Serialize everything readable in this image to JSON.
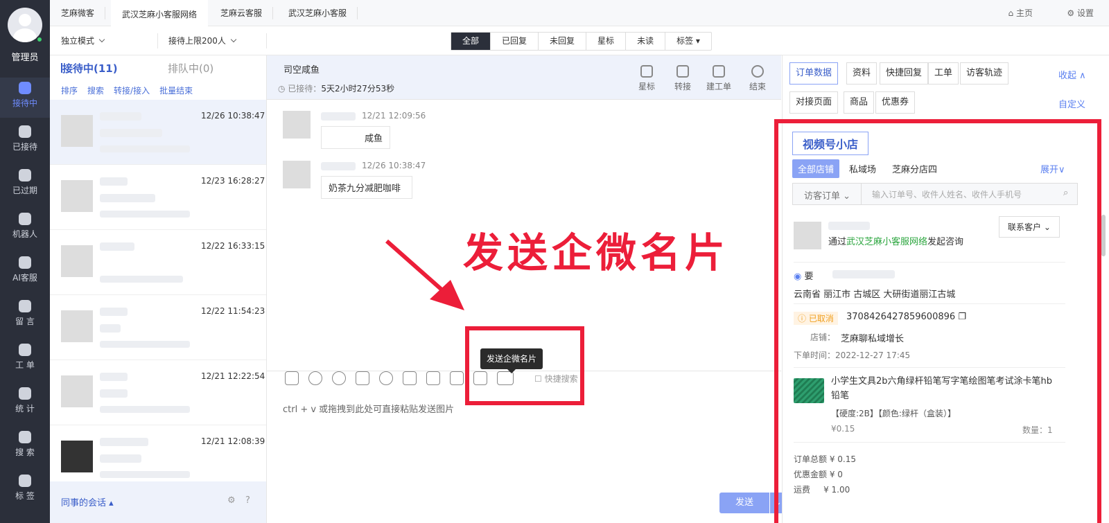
{
  "nav": {
    "admin": "管理员",
    "items": [
      {
        "label": "接待中",
        "icon": "chat-icon",
        "active": true
      },
      {
        "label": "已接待",
        "icon": "check-icon"
      },
      {
        "label": "已过期",
        "icon": "expired-icon"
      },
      {
        "label": "机器人",
        "icon": "robot-icon"
      },
      {
        "label": "AI客服",
        "icon": "ai-icon"
      },
      {
        "label": "留 言",
        "icon": "message-icon"
      },
      {
        "label": "工 单",
        "icon": "ticket-icon"
      },
      {
        "label": "统 计",
        "icon": "stats-icon"
      },
      {
        "label": "搜 索",
        "icon": "search-icon"
      },
      {
        "label": "标 签",
        "icon": "tag-icon"
      }
    ]
  },
  "tabs": [
    "芝麻微客",
    "武汉芝麻小客服网络",
    "芝麻云客服",
    "武汉芝麻小客服"
  ],
  "top": {
    "home": "主页",
    "settings": "设置"
  },
  "bar2": {
    "mode": "独立模式",
    "limit": "接待上限200人",
    "filters": [
      "全部",
      "已回复",
      "未回复",
      "星标",
      "未读",
      "标签 ▾"
    ]
  },
  "list": {
    "active_tab": "接待中(11)",
    "queue_tab": "排队中(0)",
    "actions": [
      "排序",
      "搜索",
      "转接/接入",
      "批量结束"
    ],
    "times": [
      "12/26 10:38:47",
      "12/23 16:28:27",
      "12/22 16:33:15",
      "12/22 11:54:23",
      "12/21 12:22:54",
      "12/21 12:08:39"
    ],
    "colleague": "同事的会话 ▴"
  },
  "chat": {
    "name": "司空咸鱼",
    "waited": "已接待：",
    "duration": "5天2小时27分53秒",
    "header_buttons": [
      "星标",
      "转接",
      "建工单",
      "结束"
    ],
    "messages": [
      {
        "time": "12/21 12:09:56",
        "text": "咸鱼"
      },
      {
        "time": "12/26 10:38:47",
        "text": "奶茶九分减肥咖啡"
      }
    ],
    "input_placeholder": "ctrl + v 或拖拽到此处可直接粘贴发送图片",
    "quick_search": "快捷搜索",
    "tooltip": "发送企微名片",
    "send": "发送"
  },
  "annotation": "发送企微名片",
  "right": {
    "tabs_row1": [
      "订单数据",
      "资料",
      "快捷回复",
      "工单",
      "访客轨迹"
    ],
    "collapse": "收起 ∧",
    "tabs_row2": [
      "对接页面",
      "商品",
      "优惠券"
    ],
    "customize": "自定义",
    "shop_title": "视频号小店",
    "shop_tabs": [
      "全部店铺",
      "私域场",
      "芝麻分店四"
    ],
    "expand": "展开∨",
    "order_type": "访客订单",
    "search_placeholder": "输入订单号、收件人姓名、收件人手机号",
    "contact": "联系客户",
    "via_prefix": "通过",
    "via_link": "武汉芝麻小客服网络",
    "via_suffix": "发起咨询",
    "addr_label": "要",
    "address": "云南省 丽江市 古城区 大研街道丽江古城",
    "status": "已取消",
    "order_no": "3708426427859600896",
    "store_label": "店铺：",
    "store": "芝麻聊私域增长",
    "order_time": "下单时间：2022-12-27 17:45",
    "product": "小学生文具2b六角绿杆铅笔写字笔绘图笔考试涂卡笔hb铅笔",
    "spec": "【硬度:2B】【颜色:绿杆（盒装）】",
    "price": "¥0.15",
    "qty": "数量：1",
    "total": "订单总额 ¥ 0.15",
    "discount": "优惠金额 ¥ 0",
    "freight": "运费     ¥ 1.00"
  }
}
